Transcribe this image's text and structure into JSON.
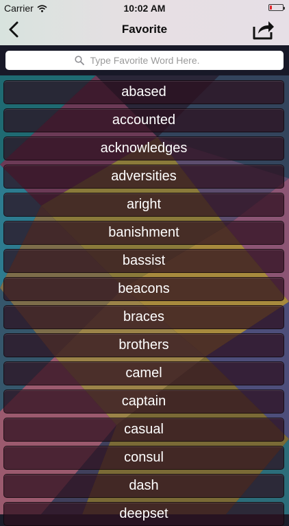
{
  "status_bar": {
    "carrier": "Carrier",
    "time": "10:02 AM"
  },
  "nav": {
    "title": "Favorite",
    "back_icon": "chevron-left-icon",
    "share_icon": "share-icon"
  },
  "search": {
    "placeholder": "Type Favorite Word Here.",
    "value": "",
    "icon": "search-icon"
  },
  "words": [
    "abased",
    "accounted",
    "acknowledges",
    "adversities",
    "aright",
    "banishment",
    "bassist",
    "beacons",
    "braces",
    "brothers",
    "camel",
    "captain",
    "casual",
    "consul",
    "dash",
    "deepset"
  ],
  "colors": {
    "nav_background": "#e2e0e2",
    "row_background": "#2d0f1e",
    "row_text": "#ffffff",
    "battery_low": "#e0262b"
  }
}
